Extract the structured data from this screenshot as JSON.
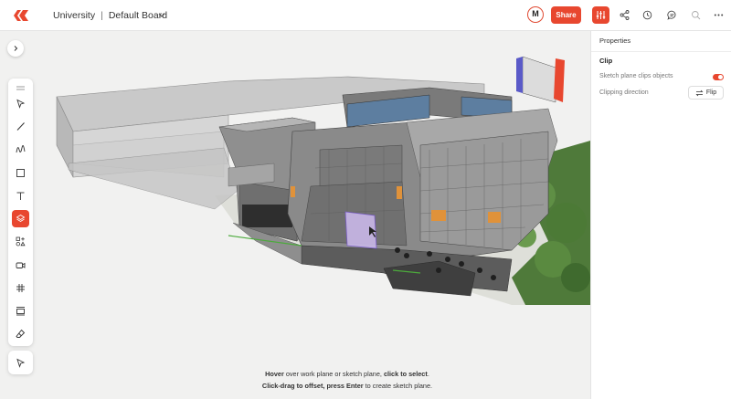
{
  "app": {
    "project": "University",
    "separator": "|",
    "board": "Default Board",
    "avatar_initial": "M",
    "share_label": "Share",
    "accent_color": "#e8472f"
  },
  "toolbar_icons": [
    "sliders-icon",
    "share-network-icon",
    "history-icon",
    "comment-icon",
    "search-icon",
    "more-icon"
  ],
  "left_tools": [
    "select-arrow-icon",
    "line-icon",
    "freehand-icon",
    "rectangle-icon",
    "text-icon",
    "layers-icon",
    "shapes-icon",
    "video-icon",
    "grid-icon",
    "frame-icon",
    "eraser-icon"
  ],
  "hint": {
    "line1_bold1": "Hover",
    "line1_text1": " over work plane or sketch plane, ",
    "line1_bold2": "click to select",
    "line1_text2": ".",
    "line2_bold1": "Click-drag to offset, press Enter",
    "line2_text1": " to create sketch plane."
  },
  "panel": {
    "title": "Properties",
    "section": "Clip",
    "row1_label": "Sketch plane clips objects",
    "row1_value": true,
    "row2_label": "Clipping direction",
    "flip_label": "Flip"
  }
}
